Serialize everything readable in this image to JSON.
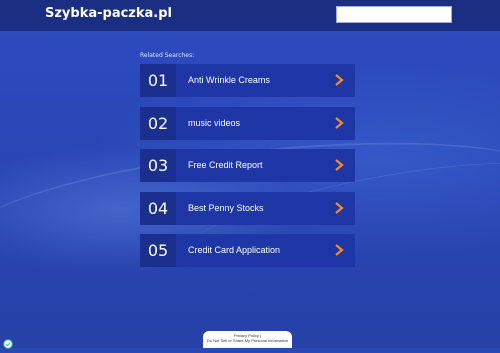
{
  "header": {
    "site_title": "Szybka-paczka.pl",
    "search_value": ""
  },
  "related_heading": "Related Searches:",
  "items": [
    {
      "number": "01",
      "label": "Anti Wrinkle Creams"
    },
    {
      "number": "02",
      "label": "music videos"
    },
    {
      "number": "03",
      "label": "Free Credit Report"
    },
    {
      "number": "04",
      "label": "Best Penny Stocks"
    },
    {
      "number": "05",
      "label": "Credit Card Application"
    }
  ],
  "footer": {
    "privacy_line": "Privacy Policy |",
    "consent_line": "Do Not Sell or Share My Personal Information"
  },
  "colors": {
    "accent_arrow": "#f28c28",
    "header_bg": "#1b2f82",
    "item_bg": "#1f36a6",
    "number_bg": "#1b2f8f"
  },
  "icons": {
    "arrow": "chevron-right-icon",
    "privacy": "privacy-shield-icon"
  }
}
